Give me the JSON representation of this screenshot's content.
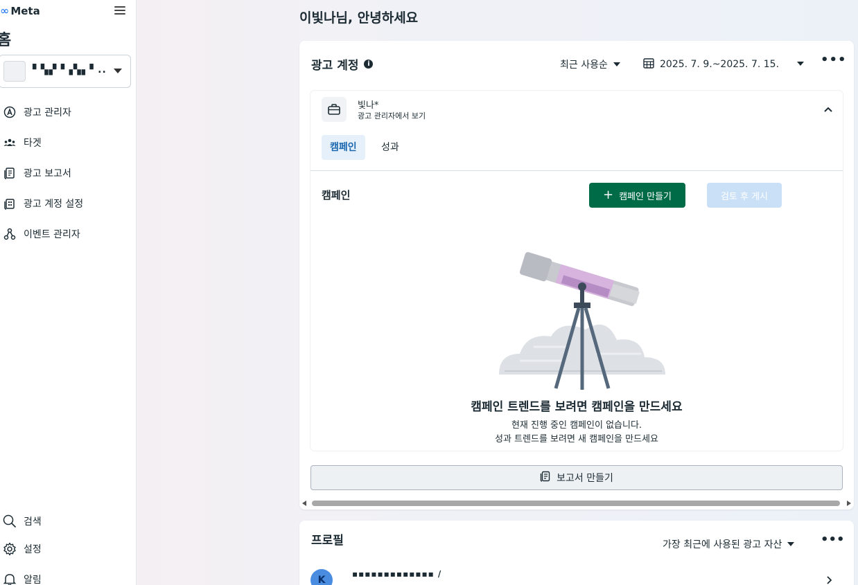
{
  "sidebar": {
    "brand": "Meta",
    "page_title": "홈",
    "account_name": "▘▚▞▝▗▚▖▘..",
    "nav": [
      {
        "label": "광고 관리자",
        "icon": "ads-manager-icon"
      },
      {
        "label": "타겟",
        "icon": "audience-icon"
      },
      {
        "label": "광고 보고서",
        "icon": "report-icon"
      },
      {
        "label": "광고 계정 설정",
        "icon": "account-settings-icon"
      },
      {
        "label": "이벤트 관리자",
        "icon": "events-manager-icon"
      }
    ],
    "bottom_nav": [
      {
        "label": "검색",
        "icon": "search-icon"
      },
      {
        "label": "설정",
        "icon": "gear-icon"
      },
      {
        "label": "알림",
        "icon": "bell-icon"
      }
    ]
  },
  "main": {
    "greeting": "이빛나님, 안녕하세요",
    "ad_accounts": {
      "title": "광고 계정",
      "sort_label": "최근 사용순",
      "date_range": "2025. 7. 9.~2025. 7. 15.",
      "more": "•••",
      "account": {
        "name": "빛나*",
        "link": "광고 관리자에서 보기"
      },
      "tabs": [
        {
          "label": "캠페인",
          "active": true
        },
        {
          "label": "성과",
          "active": false
        }
      ],
      "section_title": "캠페인",
      "create_button": "캠페인 만들기",
      "review_button": "검토 후 게시",
      "empty_title": "캠페인 트렌드를 보려면 캠페인을 만드세요",
      "empty_line1": "현재 진행 중인 캠페인이 없습니다.",
      "empty_line2": "성과 트렌드를 보려면 새 캠페인을 만드세요",
      "report_button": "보고서 만들기"
    },
    "profile": {
      "title": "프로필",
      "asset_label": "가장 최근에 사용된 광고 자산",
      "more": "•••",
      "avatar_letter": "K",
      "name": "▪▪▪▪▪▪▪▪▪▪▪▪▪ /"
    }
  },
  "colors": {
    "primary_green": "#006b47",
    "disabled_blue": "#c9e0f7",
    "tab_active_bg": "#e6f0fb",
    "brand_blue": "#0866ff"
  }
}
